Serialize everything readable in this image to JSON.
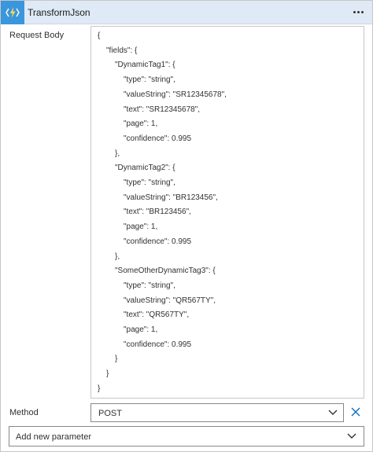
{
  "header": {
    "title": "TransformJson",
    "icon": "function-bolt-icon",
    "accent_color": "#3a96dd",
    "header_bg": "#dfeaf6"
  },
  "request_body": {
    "label": "Request Body",
    "lines": [
      {
        "text": "{",
        "indent": 0
      },
      {
        "text": "\"fields\": {",
        "indent": 1
      },
      {
        "text": "\"DynamicTag1\": {",
        "indent": 2
      },
      {
        "text": "\"type\": \"string\",",
        "indent": 3
      },
      {
        "text": "\"valueString\": \"SR12345678\",",
        "indent": 3
      },
      {
        "text": "\"text\": \"SR12345678\",",
        "indent": 3
      },
      {
        "text": "\"page\": 1,",
        "indent": 3
      },
      {
        "text": "\"confidence\": 0.995",
        "indent": 3
      },
      {
        "text": "},",
        "indent": 2
      },
      {
        "text": "\"DynamicTag2\": {",
        "indent": 2
      },
      {
        "text": "\"type\": \"string\",",
        "indent": 3
      },
      {
        "text": "\"valueString\": \"BR123456\",",
        "indent": 3
      },
      {
        "text": "\"text\": \"BR123456\",",
        "indent": 3
      },
      {
        "text": "\"page\": 1,",
        "indent": 3
      },
      {
        "text": "\"confidence\": 0.995",
        "indent": 3
      },
      {
        "text": "},",
        "indent": 2
      },
      {
        "text": "\"SomeOtherDynamicTag3\": {",
        "indent": 2
      },
      {
        "text": "\"type\": \"string\",",
        "indent": 3
      },
      {
        "text": "\"valueString\": \"QR567TY\",",
        "indent": 3
      },
      {
        "text": "\"text\": \"QR567TY\",",
        "indent": 3
      },
      {
        "text": "\"page\": 1,",
        "indent": 3
      },
      {
        "text": "\"confidence\": 0.995",
        "indent": 3
      },
      {
        "text": "}",
        "indent": 2
      },
      {
        "text": "}",
        "indent": 1
      },
      {
        "text": "}",
        "indent": 0
      }
    ]
  },
  "method": {
    "label": "Method",
    "value": "POST",
    "dropdown_icon": "chevron-down-icon",
    "clear_icon": "close-icon"
  },
  "add_parameter": {
    "label": "Add new parameter",
    "dropdown_icon": "chevron-down-icon"
  }
}
